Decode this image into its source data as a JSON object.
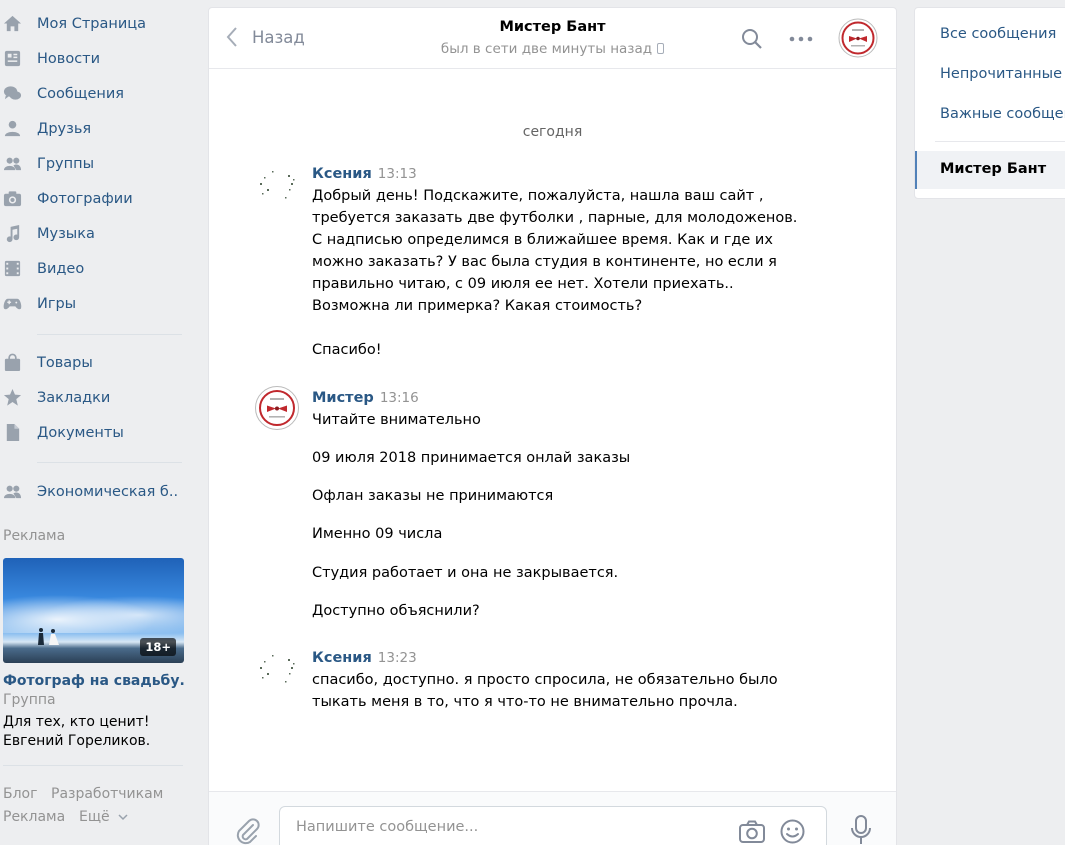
{
  "nav": {
    "items": [
      {
        "label": "Моя Страница",
        "icon": "home-icon"
      },
      {
        "label": "Новости",
        "icon": "news-icon"
      },
      {
        "label": "Сообщения",
        "icon": "messages-icon"
      },
      {
        "label": "Друзья",
        "icon": "friends-icon"
      },
      {
        "label": "Группы",
        "icon": "groups-icon"
      },
      {
        "label": "Фотографии",
        "icon": "camera-icon"
      },
      {
        "label": "Музыка",
        "icon": "music-note-icon"
      },
      {
        "label": "Видео",
        "icon": "film-icon"
      },
      {
        "label": "Игры",
        "icon": "gamepad-icon"
      },
      {
        "label": "Товары",
        "icon": "shopping-bag-icon"
      },
      {
        "label": "Закладки",
        "icon": "star-icon"
      },
      {
        "label": "Документы",
        "icon": "document-icon"
      },
      {
        "label": "Экономическая б..",
        "icon": "groups-icon"
      }
    ]
  },
  "ads": {
    "title": "Реклама",
    "badge": "18+",
    "headline": "Фотограф на свадьбу.",
    "type": "Группа",
    "description": "Для тех, кто ценит!\nЕвгений Гореликов."
  },
  "footer": {
    "blog": "Блог",
    "developers": "Разработчикам",
    "ads": "Реклама",
    "more": "Ещё"
  },
  "chat": {
    "back_label": "Назад",
    "peer_name": "Мистер Бант",
    "peer_status": "был в сети две минуты назад",
    "date_separator": "сегодня",
    "messages": [
      {
        "author": "Ксения",
        "time": "13:13",
        "text": "Добрый день! Подскажите, пожалуйста, нашла ваш сайт ,\nтребуется заказать две футболки , парные, для молодоженов.\nС надписью определимся в ближайшее время. Как и где их\nможно заказать? У вас была студия в континенте, но если я\nправильно читаю, с 09 июля ее нет. Хотели приехать..\nВозможна ли примерка? Какая стоимость?\n\nСпасибо!"
      },
      {
        "author": "Мистер",
        "time": "13:16",
        "lines": [
          "Читайте внимательно",
          "09 июля 2018 принимается онлай заказы",
          "Офлан заказы не принимаются",
          "Именно 09 числа",
          "Студия работает и она не закрывается.",
          "Доступно объяснили?"
        ]
      },
      {
        "author": "Ксения",
        "time": "13:23",
        "text": "спасибо, доступно. я просто спросила, не обязательно было\nтыкать меня в то, что я что-то не внимательно прочла."
      }
    ],
    "composer_placeholder": "Напишите сообщение..."
  },
  "right_panel": {
    "all": "Все сообщения",
    "unread": "Непрочитанные",
    "important": "Важные сообщения",
    "active_chat": "Мистер Бант"
  },
  "colors": {
    "link": "#2a5885",
    "accent": "#5181b8",
    "icon": "#99a2ad",
    "muted": "#939393",
    "background": "#edeef0"
  }
}
